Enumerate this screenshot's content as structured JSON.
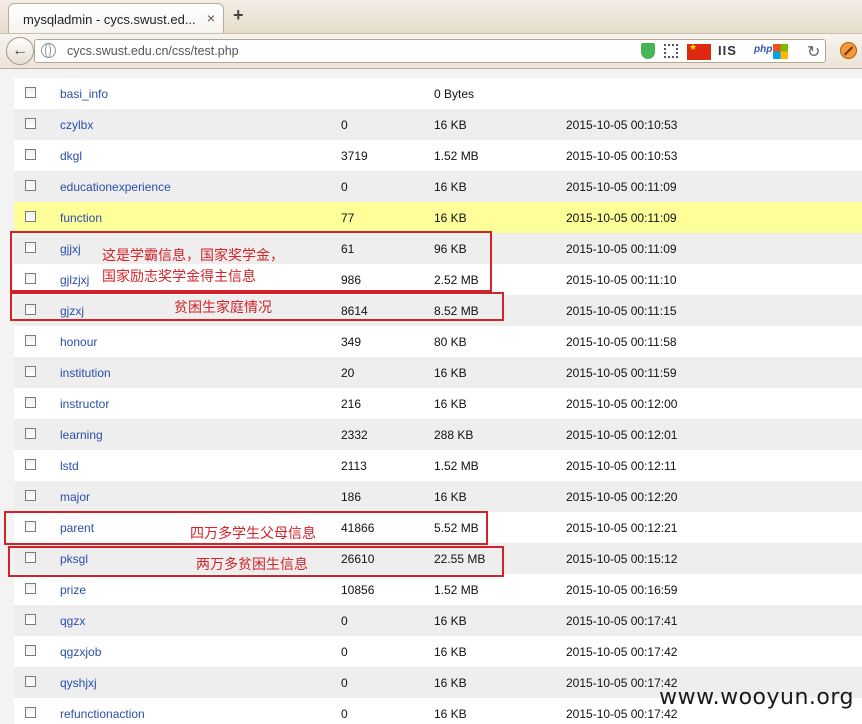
{
  "browser": {
    "tab_title": "mysqladmin - cycs.swust.ed...",
    "tab_close": "×",
    "new_tab": "+",
    "back": "←",
    "url": "cycs.swust.edu.cn/css/test.php",
    "ext_iis": "IIS",
    "ext_php": "php",
    "reload": "↻"
  },
  "tables": [
    {
      "name": "basi_info",
      "rows": "",
      "size": "0 Bytes",
      "time": ""
    },
    {
      "name": "czylbx",
      "rows": "0",
      "size": "16 KB",
      "time": "2015-10-05 00:10:53"
    },
    {
      "name": "dkgl",
      "rows": "3719",
      "size": "1.52 MB",
      "time": "2015-10-05 00:10:53"
    },
    {
      "name": "educationexperience",
      "rows": "0",
      "size": "16 KB",
      "time": "2015-10-05 00:11:09"
    },
    {
      "name": "function",
      "rows": "77",
      "size": "16 KB",
      "time": "2015-10-05 00:11:09"
    },
    {
      "name": "gjjxj",
      "rows": "61",
      "size": "96 KB",
      "time": "2015-10-05 00:11:09"
    },
    {
      "name": "gjlzjxj",
      "rows": "986",
      "size": "2.52 MB",
      "time": "2015-10-05 00:11:10"
    },
    {
      "name": "gjzxj",
      "rows": "8614",
      "size": "8.52 MB",
      "time": "2015-10-05 00:11:15"
    },
    {
      "name": "honour",
      "rows": "349",
      "size": "80 KB",
      "time": "2015-10-05 00:11:58"
    },
    {
      "name": "institution",
      "rows": "20",
      "size": "16 KB",
      "time": "2015-10-05 00:11:59"
    },
    {
      "name": "instructor",
      "rows": "216",
      "size": "16 KB",
      "time": "2015-10-05 00:12:00"
    },
    {
      "name": "learning",
      "rows": "2332",
      "size": "288 KB",
      "time": "2015-10-05 00:12:01"
    },
    {
      "name": "lstd",
      "rows": "2113",
      "size": "1.52 MB",
      "time": "2015-10-05 00:12:11"
    },
    {
      "name": "major",
      "rows": "186",
      "size": "16 KB",
      "time": "2015-10-05 00:12:20"
    },
    {
      "name": "parent",
      "rows": "41866",
      "size": "5.52 MB",
      "time": "2015-10-05 00:12:21"
    },
    {
      "name": "pksgl",
      "rows": "26610",
      "size": "22.55 MB",
      "time": "2015-10-05 00:15:12"
    },
    {
      "name": "prize",
      "rows": "10856",
      "size": "1.52 MB",
      "time": "2015-10-05 00:16:59"
    },
    {
      "name": "qgzx",
      "rows": "0",
      "size": "16 KB",
      "time": "2015-10-05 00:17:41"
    },
    {
      "name": "qgzxjob",
      "rows": "0",
      "size": "16 KB",
      "time": "2015-10-05 00:17:42"
    },
    {
      "name": "qyshjxj",
      "rows": "0",
      "size": "16 KB",
      "time": "2015-10-05 00:17:42"
    },
    {
      "name": "refunctionaction",
      "rows": "0",
      "size": "16 KB",
      "time": "2015-10-05 00:17:42"
    }
  ],
  "annotations": {
    "scholarship_line1": "这是学霸信息，国家奖学金，",
    "scholarship_line2": "国家励志奖学金得主信息",
    "poverty_family": "贫困生家庭情况",
    "parents": "四万多学生父母信息",
    "poverty_students": "两万多贫困生信息"
  },
  "watermark": "www.wooyun.org",
  "colors": {
    "link": "#2b4eab",
    "highlight_row": "#ffff99",
    "annotation_red": "#d2232a"
  }
}
